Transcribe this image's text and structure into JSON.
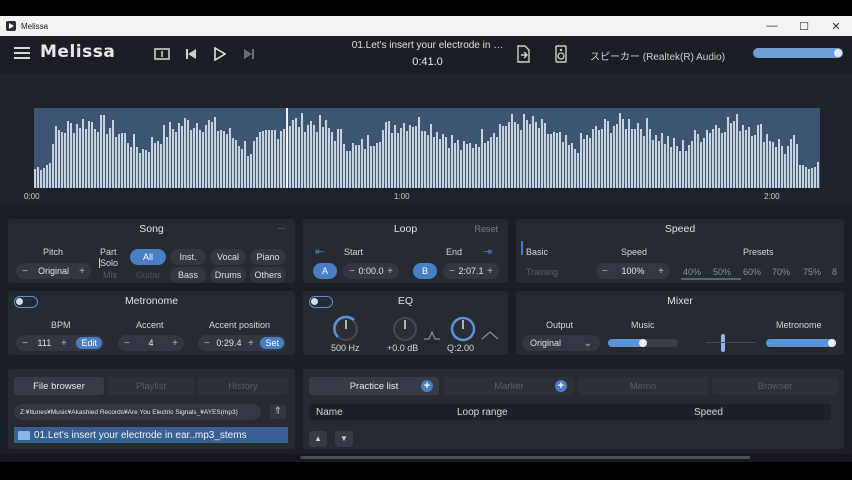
{
  "window": {
    "title": "Melissa",
    "minimize_icon": "minimize-icon",
    "maximize_icon": "maximize-icon",
    "close_icon": "close-icon"
  },
  "header": {
    "brand": "Melissa",
    "track_title": "01.Let's insert your electrode in …",
    "current_time": "0:41.0",
    "output_device": "スピーカー (Realtek(R) Audio)",
    "volume_percent": 100
  },
  "waveform": {
    "ticks": [
      "0:00",
      "1:00",
      "2:00"
    ],
    "playhead_fraction": 0.32
  },
  "song": {
    "title": "Song",
    "more": "...",
    "pitch_label": "Pitch",
    "pitch_value": "Original",
    "part_label": "Part",
    "solo_label": "Solo",
    "mix_label": "Mix",
    "parts": [
      "All",
      "Inst.",
      "Vocal",
      "Piano",
      "Guitar",
      "Bass",
      "Drums",
      "Others"
    ],
    "active_part": "All"
  },
  "loop": {
    "title": "Loop",
    "reset": "Reset",
    "start_label": "Start",
    "end_label": "End",
    "a_label": "A",
    "b_label": "B",
    "start_value": "0:00.0",
    "end_value": "2:07.1"
  },
  "speed": {
    "title": "Speed",
    "basic": "Basic",
    "training": "Training",
    "speed_label": "Speed",
    "speed_value": "100%",
    "presets_label": "Presets",
    "presets": [
      "40%",
      "50%",
      "60%",
      "70%",
      "75%",
      "8"
    ]
  },
  "metronome": {
    "title": "Metronome",
    "bpm_label": "BPM",
    "bpm_value": "111",
    "edit": "Edit",
    "accent_label": "Accent",
    "accent_value": "4",
    "accent_pos_label": "Accent position",
    "accent_pos_value": "0:29.4",
    "set": "Set"
  },
  "eq": {
    "title": "EQ",
    "freq": "500 Hz",
    "gain": "+0.0 dB",
    "q": "Q:2.00"
  },
  "mixer": {
    "title": "Mixer",
    "output_label": "Output",
    "output_value": "Original",
    "music_label": "Music",
    "metronome_label": "Metronome"
  },
  "browser": {
    "tabs": [
      "File browser",
      "Playlist",
      "History"
    ],
    "path": "Z:¥Itunes¥Music¥Akashied Records¥Are You Electric Signals_¥AYES(mp3)",
    "item": "01.Let's insert your electrode in ear..mp3_stems"
  },
  "practice": {
    "tabs": [
      "Practice list",
      "Marker",
      "Memo",
      "Browser"
    ],
    "columns": [
      "Name",
      "Loop range",
      "Speed"
    ]
  }
}
